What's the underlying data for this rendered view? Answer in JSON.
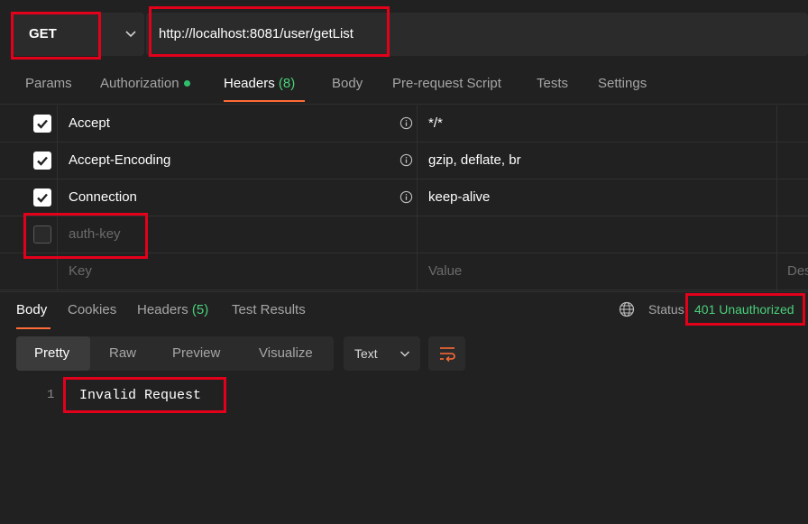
{
  "request": {
    "method": "GET",
    "url": "http://localhost:8081/user/getList"
  },
  "request_tabs": [
    {
      "label": "Params"
    },
    {
      "label": "Authorization"
    },
    {
      "label": "Headers",
      "count": "(8)"
    },
    {
      "label": "Body"
    },
    {
      "label": "Pre-request Script"
    },
    {
      "label": "Tests"
    },
    {
      "label": "Settings"
    }
  ],
  "headers": [
    {
      "key": "Accept",
      "value": "*/*",
      "checked": true
    },
    {
      "key": "Accept-Encoding",
      "value": "gzip, deflate, br",
      "checked": true
    },
    {
      "key": "Connection",
      "value": "keep-alive",
      "checked": true
    },
    {
      "key": "auth-key",
      "value": "",
      "checked": false
    }
  ],
  "headers_placeholder": {
    "key": "Key",
    "value": "Value",
    "description": "Des"
  },
  "response_tabs": [
    {
      "label": "Body"
    },
    {
      "label": "Cookies"
    },
    {
      "label": "Headers",
      "count": "(5)"
    },
    {
      "label": "Test Results"
    }
  ],
  "status": {
    "label": "Status:",
    "value": "401 Unauthorized"
  },
  "view_modes": [
    "Pretty",
    "Raw",
    "Preview",
    "Visualize"
  ],
  "format": "Text",
  "body_lines": [
    {
      "number": "1",
      "text": "Invalid Request"
    }
  ],
  "colors": {
    "accent": "#ff6c37",
    "success": "#4ad07a",
    "annotation": "#e3001b",
    "background": "#212121"
  },
  "icons": [
    "chevron-down-icon",
    "info-icon",
    "checkbox-check-icon",
    "globe-icon",
    "wrap-lines-icon"
  ]
}
